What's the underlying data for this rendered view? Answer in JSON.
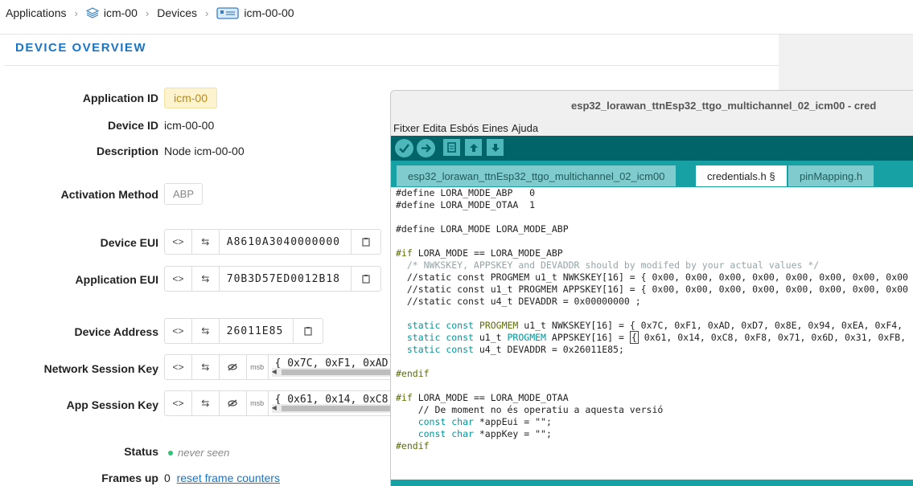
{
  "breadcrumb": {
    "applications": "Applications",
    "app": "icm-00",
    "devices": "Devices",
    "device": "icm-00-00"
  },
  "overview": {
    "title": "DEVICE OVERVIEW",
    "application_id_label": "Application ID",
    "application_id": "icm-00",
    "device_id_label": "Device ID",
    "device_id": "icm-00-00",
    "description_label": "Description",
    "description": "Node icm-00-00",
    "activation_label": "Activation Method",
    "activation": "ABP",
    "device_eui_label": "Device EUI",
    "device_eui": "A8610A3040000000",
    "app_eui_label": "Application EUI",
    "app_eui": "70B3D57ED0012B18",
    "dev_addr_label": "Device Address",
    "dev_addr": "26011E85",
    "nwk_key_label": "Network Session Key",
    "nwk_key": "{ 0x7C, 0xF1, 0xAD",
    "app_key_label": "App Session Key",
    "app_key": "{ 0x61, 0x14, 0xC8",
    "msb": "msb",
    "status_label": "Status",
    "status": "never seen",
    "frames_up_label": "Frames up",
    "frames_up": "0",
    "reset_link": "reset frame counters"
  },
  "ide": {
    "window_title": "esp32_lorawan_ttnEsp32_ttgo_multichannel_02_icm00 - cred",
    "menu": [
      "Fitxer",
      "Edita",
      "Esbós",
      "Eines",
      "Ajuda"
    ],
    "tabs": [
      "esp32_lorawan_ttnEsp32_ttgo_multichannel_02_icm00",
      "credentials.h §",
      "pinMapping.h"
    ],
    "code": {
      "l1": "#define LORA_MODE_ABP   0",
      "l2": "#define LORA_MODE_OTAA  1",
      "l3": "",
      "l4": "#define LORA_MODE LORA_MODE_ABP",
      "l5": "",
      "l6_kw": "#if",
      "l6": " LORA_MODE == LORA_MODE_ABP",
      "l7": "  /* NWKSKEY, APPSKEY and DEVADDR should by modifed by your actual values */",
      "l8": "  //static const PROGMEM u1_t NWKSKEY[16] = { 0x00, 0x00, 0x00, 0x00, 0x00, 0x00, 0x00, 0x00",
      "l9": "  //static const u1_t PROGMEM APPSKEY[16] = { 0x00, 0x00, 0x00, 0x00, 0x00, 0x00, 0x00, 0x00",
      "l10": "  //static const u4_t DEVADDR = 0x00000000 ;",
      "l11": "",
      "l12_a": "static const",
      "l12_b": "PROGMEM",
      "l12_c": " u1_t NWKSKEY[16] = { 0x7C, 0xF1, 0xAD, 0xD7, 0x8E, 0x94, 0xEA, 0xF4,",
      "l13_a": "static const",
      "l13_b": " u1_t ",
      "l13_c": "PROGMEM",
      "l13_d": " APPSKEY[16] = ",
      "l13_e": "{",
      "l13_f": " 0x61, 0x14, 0xC8, 0xF8, 0x71, 0x6D, 0x31, 0xFB,",
      "l14_a": "static const",
      "l14_b": " u4_t DEVADDR = 0x26011E85;",
      "l15": "",
      "l16": "#endif",
      "l17": "",
      "l18_kw": "#if",
      "l18": " LORA_MODE == LORA_MODE_OTAA",
      "l19": "    // De moment no és operatiu a aquesta versió",
      "l20_a": "const char",
      "l20_b": " *appEui = \"\";",
      "l21_a": "const char",
      "l21_b": " *appKey = \"\";",
      "l22": "#endif"
    }
  }
}
